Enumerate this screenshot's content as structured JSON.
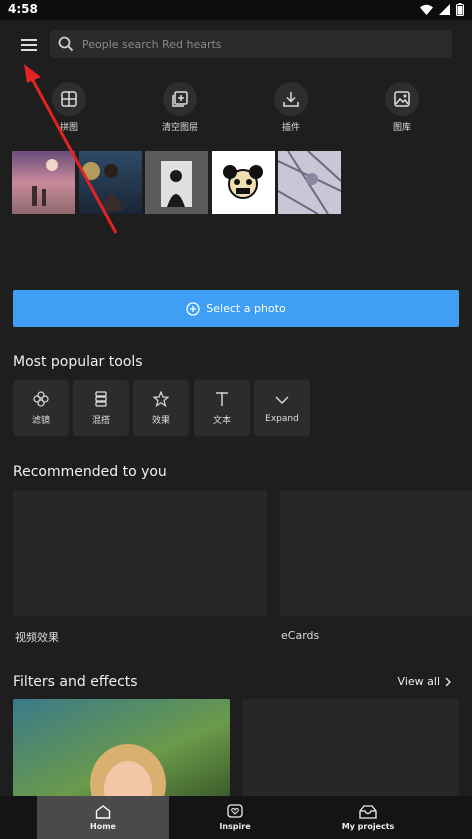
{
  "status": {
    "time": "4:58"
  },
  "search": {
    "placeholder": "People search Red hearts"
  },
  "quick_actions": [
    {
      "label": "拼图",
      "icon": "collage-icon"
    },
    {
      "label": "清空图层",
      "icon": "clear-layers-icon"
    },
    {
      "label": "插件",
      "icon": "download-icon"
    },
    {
      "label": "图库",
      "icon": "gallery-icon"
    }
  ],
  "select_photo": {
    "label": "Select a photo"
  },
  "popular_tools": {
    "title": "Most popular tools",
    "items": [
      {
        "label": "滤镜",
        "icon": "flower-icon"
      },
      {
        "label": "混搭",
        "icon": "stack-icon"
      },
      {
        "label": "效果",
        "icon": "star-icon"
      },
      {
        "label": "文本",
        "icon": "text-icon"
      },
      {
        "label": "Expand",
        "icon": "chevron-down-icon"
      }
    ]
  },
  "recommended": {
    "title": "Recommended to you",
    "items": [
      {
        "label": "视频效果"
      },
      {
        "label": "eCards"
      }
    ]
  },
  "filters": {
    "title": "Filters and effects",
    "view_all": "View all"
  },
  "nav": [
    {
      "label": "Home",
      "icon": "home-icon",
      "active": true
    },
    {
      "label": "Inspire",
      "icon": "heart-icon",
      "active": false
    },
    {
      "label": "My projects",
      "icon": "folder-icon",
      "active": false
    }
  ],
  "colors": {
    "accent": "#3f9ff4",
    "background": "#1e1e1e",
    "arrow": "#e02424"
  }
}
